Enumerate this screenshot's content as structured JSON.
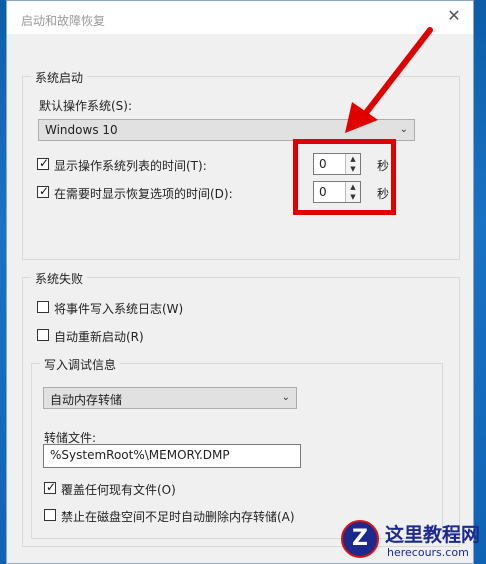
{
  "dialog": {
    "title": "启动和故障恢复",
    "close_glyph": "✕"
  },
  "system_startup": {
    "legend": "系统启动",
    "default_os_label": "默认操作系统(S):",
    "default_os_value": "Windows 10",
    "show_os_list": {
      "checked": true,
      "label": "显示操作系统列表的时间(T):",
      "value": "0"
    },
    "show_recovery": {
      "checked": true,
      "label": "在需要时显示恢复选项的时间(D):",
      "value": "0"
    },
    "seconds_label": "秒"
  },
  "system_failure": {
    "legend": "系统失败",
    "write_event": {
      "checked": false,
      "label": "将事件写入系统日志(W)"
    },
    "auto_restart": {
      "checked": false,
      "label": "自动重新启动(R)"
    },
    "debug_info": {
      "legend": "写入调试信息",
      "dump_type": "自动内存转储",
      "dump_file_label": "转储文件:",
      "dump_file_value": "%SystemRoot%\\MEMORY.DMP",
      "overwrite": {
        "checked": true,
        "label": "覆盖任何现有文件(O)"
      },
      "disable_auto_delete": {
        "checked": false,
        "label": "禁止在磁盘空间不足时自动删除内存转储(A)"
      }
    }
  },
  "annotation": {
    "color": "#e00000"
  },
  "watermark": {
    "site_name": "这里教程网",
    "url": "herecours.com",
    "logo_letter": "Z"
  }
}
